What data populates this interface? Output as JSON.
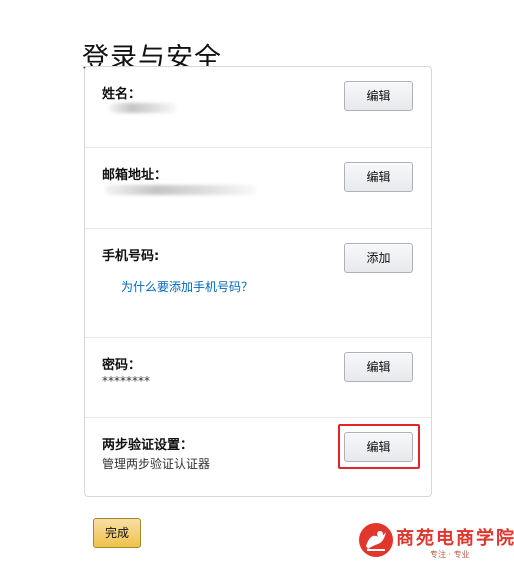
{
  "page": {
    "title": "登录与安全"
  },
  "rows": {
    "name": {
      "label": "姓名：",
      "button": "编辑"
    },
    "email": {
      "label": "邮箱地址：",
      "button": "编辑"
    },
    "phone": {
      "label": "手机号码:",
      "button": "添加",
      "link": "为什么要添加手机号码？"
    },
    "password": {
      "label": "密码：",
      "value": "********",
      "button": "编辑"
    },
    "two_step": {
      "label": "两步验证设置：",
      "value": "管理两步验证认证器",
      "button": "编辑"
    }
  },
  "footer": {
    "done_label": "完成"
  },
  "watermark": {
    "title": "商苑电商学院",
    "subtitle": "专注 · 专业"
  },
  "colors": {
    "highlight": "#e0252b",
    "link": "#0066c0",
    "done_button": "#f0c14b",
    "logo": "#e0362c"
  }
}
